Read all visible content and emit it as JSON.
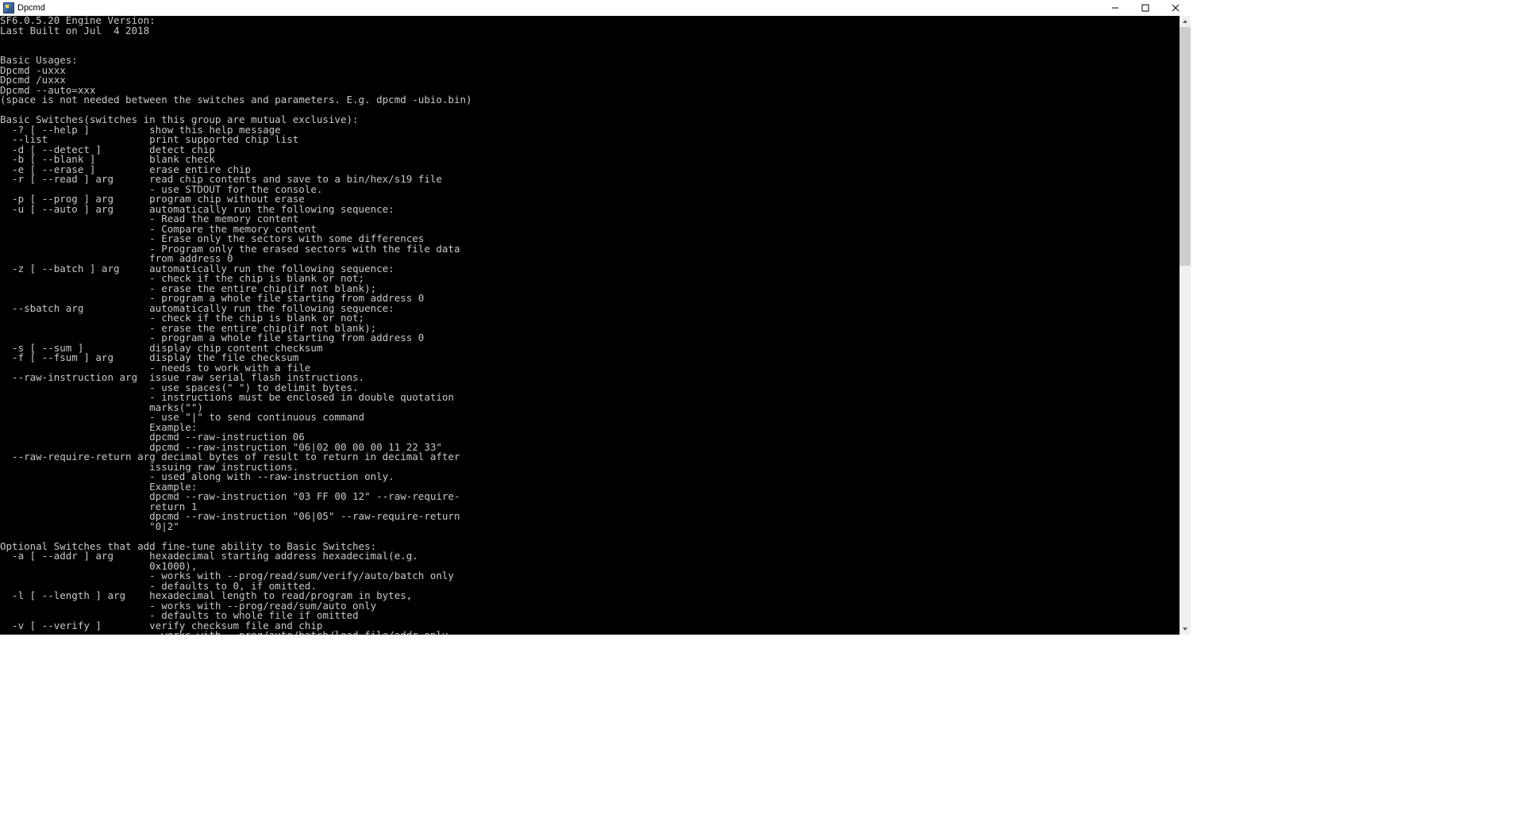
{
  "window": {
    "title": "Dpcmd"
  },
  "console_text": "SF6.0.5.20 Engine Version:\nLast Built on Jul  4 2018\n\n\nBasic Usages:\nDpcmd -uxxx\nDpcmd /uxxx\nDpcmd --auto=xxx\n(space is not needed between the switches and parameters. E.g. dpcmd -ubio.bin)\n\nBasic Switches(switches in this group are mutual exclusive):\n  -? [ --help ]          show this help message\n  --list                 print supported chip list\n  -d [ --detect ]        detect chip\n  -b [ --blank ]         blank check\n  -e [ --erase ]         erase entire chip\n  -r [ --read ] arg      read chip contents and save to a bin/hex/s19 file\n                         - use STDOUT for the console.\n  -p [ --prog ] arg      program chip without erase\n  -u [ --auto ] arg      automatically run the following sequence:\n                         - Read the memory content\n                         - Compare the memory content\n                         - Erase only the sectors with some differences\n                         - Program only the erased sectors with the file data\n                         from address 0\n  -z [ --batch ] arg     automatically run the following sequence:\n                         - check if the chip is blank or not;\n                         - erase the entire chip(if not blank);\n                         - program a whole file starting from address 0\n  --sbatch arg           automatically run the following sequence:\n                         - check if the chip is blank or not;\n                         - erase the entire chip(if not blank);\n                         - program a whole file starting from address 0\n  -s [ --sum ]           display chip content checksum\n  -f [ --fsum ] arg      display the file checksum\n                         - needs to work with a file\n  --raw-instruction arg  issue raw serial flash instructions.\n                         - use spaces(\" \") to delimit bytes.\n                         - instructions must be enclosed in double quotation\n                         marks(\"\")\n                         - use \"|\" to send continuous command\n                         Example:\n                         dpcmd --raw-instruction 06\n                         dpcmd --raw-instruction \"06|02 00 00 00 11 22 33\"\n  --raw-require-return arg decimal bytes of result to return in decimal after\n                         issuing raw instructions.\n                         - used along with --raw-instruction only.\n                         Example:\n                         dpcmd --raw-instruction \"03 FF 00 12\" --raw-require-\n                         return 1\n                         dpcmd --raw-instruction \"06|05\" --raw-require-return\n                         \"0|2\"\n\nOptional Switches that add fine-tune ability to Basic Switches:\n  -a [ --addr ] arg      hexadecimal starting address hexadecimal(e.g.\n                         0x1000),\n                         - works with --prog/read/sum/verify/auto/batch only\n                         - defaults to 0, if omitted.\n  -l [ --length ] arg    hexadecimal length to read/program in bytes,\n                         - works with --prog/read/sum/auto only\n                         - defaults to whole file if omitted\n  -v [ --verify ]        verify checksum file and chip\n                         - works with --prog/auto/batch/load-file/addr only"
}
